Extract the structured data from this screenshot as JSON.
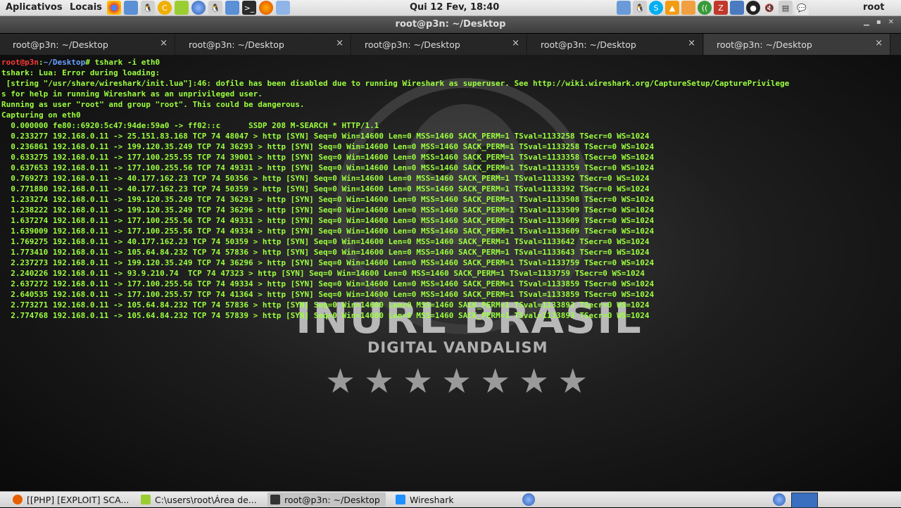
{
  "top_panel": {
    "applications": "Aplicativos",
    "places": "Locais",
    "clock": "Qui 12 Fev, 18:40",
    "user": "root",
    "launcher_icons": [
      "chrome-icon",
      "pidgin-icon",
      "tux-icon",
      "clementine-icon",
      "notes-icon",
      "globe-icon",
      "tux-icon",
      "folder-icon",
      "terminal-icon",
      "firefox-icon",
      "package-icon"
    ],
    "tray_icons": [
      "bluetooth-icon",
      "tux-icon",
      "skype-icon",
      "vlc-icon",
      "weather-icon",
      "network-icon",
      "filezilla-icon",
      "network-monitor-icon",
      "power-icon",
      "volume-icon",
      "printer-icon",
      "chat-icon"
    ]
  },
  "window": {
    "title": "root@p3n: ~/Desktop",
    "tabs": [
      {
        "label": "root@p3n: ~/Desktop",
        "close": "×"
      },
      {
        "label": "root@p3n: ~/Desktop",
        "close": "×"
      },
      {
        "label": "root@p3n: ~/Desktop",
        "close": "×"
      },
      {
        "label": "root@p3n: ~/Desktop",
        "close": "×"
      },
      {
        "label": "root@p3n: ~/Desktop",
        "close": "×"
      }
    ]
  },
  "terminal": {
    "prompt_user": "root@p3n",
    "prompt_sep": ":",
    "prompt_path": "~/Desktop",
    "command": "# tshark -i eth0",
    "output": [
      "tshark: Lua: Error during loading:",
      " [string \"/usr/share/wireshark/init.lua\"]:46: dofile has been disabled due to running Wireshark as superuser. See http://wiki.wireshark.org/CaptureSetup/CapturePrivilege",
      "s for help in running Wireshark as an unprivileged user.",
      "Running as user \"root\" and group \"root\". This could be dangerous.",
      "Capturing on eth0",
      "  0.000000 fe80::6920:5c47:94de:59a0 -> ff02::c      SSDP 208 M-SEARCH * HTTP/1.1",
      "  0.233277 192.168.0.11 -> 25.151.83.168 TCP 74 48047 > http [SYN] Seq=0 Win=14600 Len=0 MSS=1460 SACK_PERM=1 TSval=1133258 TSecr=0 WS=1024",
      "  0.236861 192.168.0.11 -> 199.120.35.249 TCP 74 36293 > http [SYN] Seq=0 Win=14600 Len=0 MSS=1460 SACK_PERM=1 TSval=1133258 TSecr=0 WS=1024",
      "  0.633275 192.168.0.11 -> 177.100.255.55 TCP 74 39001 > http [SYN] Seq=0 Win=14600 Len=0 MSS=1460 SACK_PERM=1 TSval=1133358 TSecr=0 WS=1024",
      "  0.637653 192.168.0.11 -> 177.100.255.56 TCP 74 49331 > http [SYN] Seq=0 Win=14600 Len=0 MSS=1460 SACK_PERM=1 TSval=1133359 TSecr=0 WS=1024",
      "  0.769273 192.168.0.11 -> 40.177.162.23 TCP 74 50356 > http [SYN] Seq=0 Win=14600 Len=0 MSS=1460 SACK_PERM=1 TSval=1133392 TSecr=0 WS=1024",
      "  0.771880 192.168.0.11 -> 40.177.162.23 TCP 74 50359 > http [SYN] Seq=0 Win=14600 Len=0 MSS=1460 SACK_PERM=1 TSval=1133392 TSecr=0 WS=1024",
      "  1.233274 192.168.0.11 -> 199.120.35.249 TCP 74 36293 > http [SYN] Seq=0 Win=14600 Len=0 MSS=1460 SACK_PERM=1 TSval=1133508 TSecr=0 WS=1024",
      "  1.238222 192.168.0.11 -> 199.120.35.249 TCP 74 36296 > http [SYN] Seq=0 Win=14600 Len=0 MSS=1460 SACK_PERM=1 TSval=1133509 TSecr=0 WS=1024",
      "  1.637274 192.168.0.11 -> 177.100.255.56 TCP 74 49331 > http [SYN] Seq=0 Win=14600 Len=0 MSS=1460 SACK_PERM=1 TSval=1133609 TSecr=0 WS=1024",
      "  1.639009 192.168.0.11 -> 177.100.255.56 TCP 74 49334 > http [SYN] Seq=0 Win=14600 Len=0 MSS=1460 SACK_PERM=1 TSval=1133609 TSecr=0 WS=1024",
      "  1.769275 192.168.0.11 -> 40.177.162.23 TCP 74 50359 > http [SYN] Seq=0 Win=14600 Len=0 MSS=1460 SACK_PERM=1 TSval=1133642 TSecr=0 WS=1024",
      "  1.773410 192.168.0.11 -> 105.64.84.232 TCP 74 57836 > http [SYN] Seq=0 Win=14600 Len=0 MSS=1460 SACK_PERM=1 TSval=1133643 TSecr=0 WS=1024",
      "  2.237273 192.168.0.11 -> 199.120.35.249 TCP 74 36296 > http [SYN] Seq=0 Win=14600 Len=0 MSS=1460 SACK_PERM=1 TSval=1133759 TSecr=0 WS=1024",
      "  2.240226 192.168.0.11 -> 93.9.210.74  TCP 74 47323 > http [SYN] Seq=0 Win=14600 Len=0 MSS=1460 SACK_PERM=1 TSval=1133759 TSecr=0 WS=1024",
      "  2.637272 192.168.0.11 -> 177.100.255.56 TCP 74 49334 > http [SYN] Seq=0 Win=14600 Len=0 MSS=1460 SACK_PERM=1 TSval=1133859 TSecr=0 WS=1024",
      "  2.640535 192.168.0.11 -> 177.100.255.57 TCP 74 41364 > http [SYN] Seq=0 Win=14600 Len=0 MSS=1460 SACK_PERM=1 TSval=1133859 TSecr=0 WS=1024",
      "  2.773271 192.168.0.11 -> 105.64.84.232 TCP 74 57836 > http [SYN] Seq=0 Win=14600 Len=0 MSS=1460 SACK_PERM=1 TSval=1133893 TSecr=0 WS=1024",
      "  2.774768 192.168.0.11 -> 105.64.84.232 TCP 74 57839 > http [SYN] Seq=0 Win=14600 Len=0 MSS=1460 SACK_PERM=1 TSval=1133893 TSecr=0 WS=1024"
    ],
    "wallpaper_text": "INURL BRASIL",
    "wallpaper_subtext": "DIGITAL VANDALISM",
    "wallpaper_stars": "★★★★★★★"
  },
  "taskbar": [
    {
      "label": "[[PHP] [EXPLOIT] SCA...",
      "icon": "firefox-icon",
      "color": "#e66000"
    },
    {
      "label": "C:\\users\\root\\Área de...",
      "icon": "notes-icon",
      "color": "#9acd32"
    },
    {
      "label": "root@p3n: ~/Desktop",
      "icon": "terminal-icon",
      "color": "#333333"
    },
    {
      "label": "Wireshark",
      "icon": "wireshark-icon",
      "color": "#1e90ff"
    }
  ],
  "colors": {
    "terminal_text": "#9bff3f",
    "prompt_user": "#ff3a3a",
    "prompt_path": "#6aa0ff"
  }
}
